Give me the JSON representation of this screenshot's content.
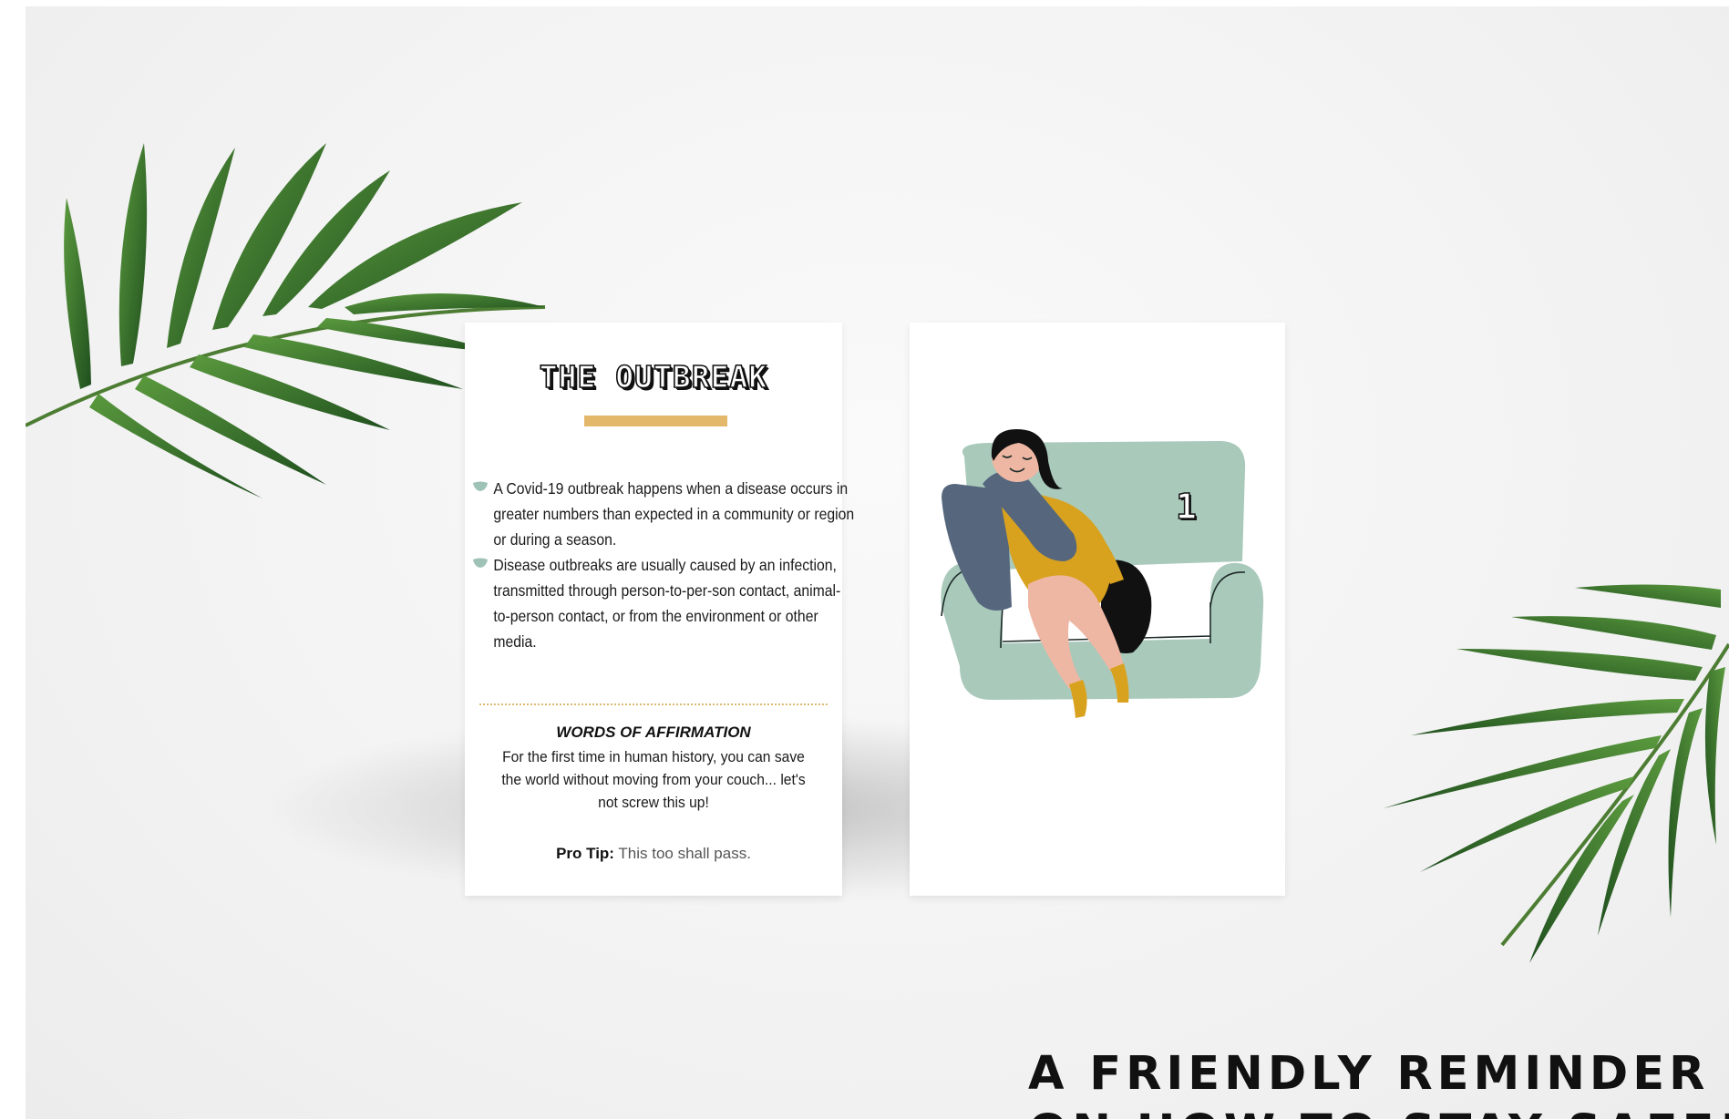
{
  "card_front": {
    "title": "THE OUTBREAK",
    "bullets": [
      "A Covid-19 outbreak happens when a disease occurs in greater numbers than expected in a community or region or during a season.",
      "Disease outbreaks are usually caused by an infection, transmitted through person-to-per-son contact, animal-to-person contact, or from the environment or other media."
    ],
    "affirmation_title": "WORDS OF AFFIRMATION",
    "affirmation_text": "For the first time in human history, you can save the world without moving from your couch... let's not screw this up!",
    "pro_tip_label": "Pro Tip:",
    "pro_tip_text": "This too shall pass."
  },
  "card_back": {
    "card_number": "1"
  },
  "headline": {
    "line1": "A FRIENDLY REMINDER",
    "line2": "ON HOW TO STAY SAFE!"
  },
  "colors": {
    "accent_gold": "#e4b86a",
    "sofa_green": "#a9c9bb",
    "pillow_slate": "#56677d",
    "shirt_mustard": "#d9a21e",
    "skin": "#eeb7a3",
    "leaf_green": "#2f6b2a"
  }
}
